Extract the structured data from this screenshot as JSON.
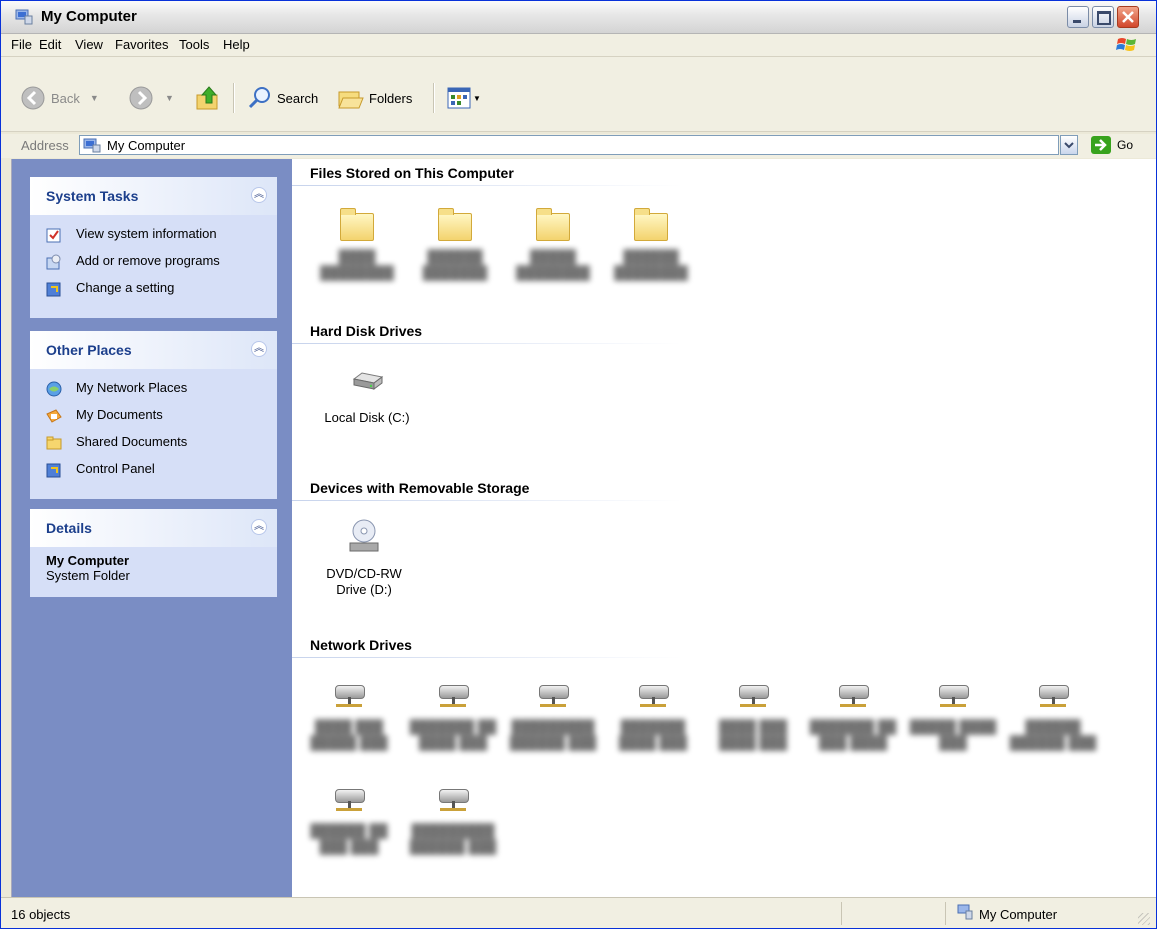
{
  "window": {
    "title": "My Computer"
  },
  "menu": [
    "File",
    "Edit",
    "View",
    "Favorites",
    "Tools",
    "Help"
  ],
  "toolbar": {
    "back": "Back",
    "search": "Search",
    "folders": "Folders"
  },
  "address": {
    "label": "Address",
    "value": "My Computer",
    "go": "Go"
  },
  "sidebar": {
    "system_tasks": {
      "title": "System Tasks",
      "items": [
        "View system information",
        "Add or remove programs",
        "Change a setting"
      ]
    },
    "other_places": {
      "title": "Other Places",
      "items": [
        "My Network Places",
        "My Documents",
        "Shared Documents",
        "Control Panel"
      ]
    },
    "details": {
      "title": "Details",
      "name": "My Computer",
      "type": "System Folder"
    }
  },
  "content": {
    "files_stored": {
      "title": "Files Stored on This Computer"
    },
    "hard_disks": {
      "title": "Hard Disk Drives",
      "items": [
        "Local Disk (C:)"
      ]
    },
    "removable": {
      "title": "Devices with Removable Storage",
      "items": [
        "DVD/CD-RW\nDrive (D:)"
      ]
    },
    "network": {
      "title": "Network Drives"
    }
  },
  "status": {
    "left": "16 objects",
    "right": "My Computer"
  }
}
